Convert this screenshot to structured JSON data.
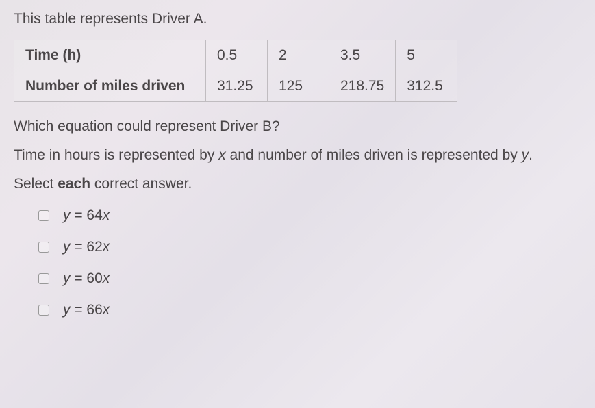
{
  "intro": "This table represents Driver A.",
  "table": {
    "row0": {
      "label": "Time (h)",
      "c0": "0.5",
      "c1": "2",
      "c2": "3.5",
      "c3": "5"
    },
    "row1": {
      "label": "Number of miles driven",
      "c0": "31.25",
      "c1": "125",
      "c2": "218.75",
      "c3": "312.5"
    }
  },
  "question": "Which equation could represent Driver B?",
  "desc_prefix": "Time in hours is represented by ",
  "desc_x": "x",
  "desc_mid": " and number of miles driven is represented by ",
  "desc_y": "y",
  "desc_suffix": ".",
  "select_prefix": "Select ",
  "select_bold": "each",
  "select_suffix": " correct answer.",
  "options": {
    "o0": {
      "y": "y",
      "eq": " = 64",
      "x": "x"
    },
    "o1": {
      "y": "y",
      "eq": " = 62",
      "x": "x"
    },
    "o2": {
      "y": "y",
      "eq": " = 60",
      "x": "x"
    },
    "o3": {
      "y": "y",
      "eq": " = 66",
      "x": "x"
    }
  },
  "chart_data": {
    "type": "table",
    "title": "Driver A",
    "columns": [
      "Time (h)",
      "Number of miles driven"
    ],
    "rows": [
      {
        "time_h": 0.5,
        "miles": 31.25
      },
      {
        "time_h": 2,
        "miles": 125
      },
      {
        "time_h": 3.5,
        "miles": 218.75
      },
      {
        "time_h": 5,
        "miles": 312.5
      }
    ]
  }
}
